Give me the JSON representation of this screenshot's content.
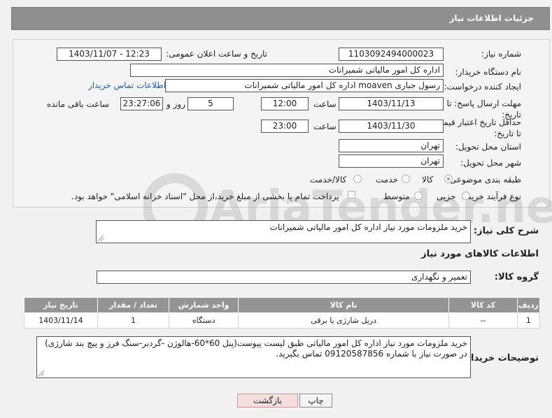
{
  "header": {
    "title": "جزئیات اطلاعات نیاز"
  },
  "fields": {
    "need_number_label": "شماره نیاز:",
    "need_number": "1103092494000023",
    "announce_label": "تاریخ و ساعت اعلان عمومی:",
    "announce_value": "1403/11/07 - 12:23",
    "buyer_org_label": "نام دستگاه خریدار:",
    "buyer_org": "اداره کل امور مالیاتی شمیرانات",
    "creator_label": "ایجاد کننده درخواست:",
    "creator": "رسول جباری moaven اداره کل امور مالیاتی شمیرانات",
    "contact_link": "اطلاعات تماس خریدار",
    "reply_deadline_label": "مهلت ارسال پاسخ: تا تاریخ:",
    "reply_date": "1403/11/13",
    "time_label": "ساعت",
    "reply_time": "12:00",
    "days_value": "5",
    "days_and_label": "روز و",
    "remaining_time": "23:27:06",
    "remaining_label": "ساعت باقی مانده",
    "price_deadline_label": "حداقل تاریخ اعتبار قیمت: تا تاریخ:",
    "price_date": "1403/11/30",
    "price_time": "23:00",
    "province_label": "استان محل تحویل:",
    "province": "تهران",
    "city_label": "شهر محل تحویل:",
    "city": "تهران",
    "category_label": "طبقه بندی موضوعی:",
    "category_options": [
      "کالا",
      "خدمت",
      "کالا/خدمت"
    ],
    "process_label": "نوع فرآیند خرید :",
    "process_options": [
      "جزیی",
      "متوسط"
    ],
    "payment_note": "پرداخت تمام یا بخشی از مبلغ خرید،از محل \"اسناد خزانه اسلامی\" خواهد بود."
  },
  "general_desc": {
    "label": "شرح کلی نیاز:",
    "value": "خرید ملزومات مورد نیاز اداره کل امور مالیاتی شمیرانات"
  },
  "goods_info_title": "اطلاعات کالاهای مورد نیاز",
  "goods_group": {
    "label": "گروه کالا:",
    "value": "تعمیر و نگهداری"
  },
  "table": {
    "headers": [
      "ردیف",
      "کد کالا",
      "نام کالا",
      "واحد شمارش",
      "تعداد / مقدار",
      "تاریخ نیاز"
    ],
    "rows": [
      [
        "1",
        "--",
        "دریل شارژی یا برقی",
        "دستگاه",
        "1",
        "1403/11/14"
      ]
    ]
  },
  "buyer_notes": {
    "label": "توضیحات خریدار:",
    "line1": "خرید ملزومات مورد نیاز اداره کل امور مالیاتی طبق لیست پیوست(پنل 60*60-هالوژن -گردبر-سنگ فرز و پیچ بند شارژی)",
    "line2": "در صورت نیاز با شماره 09120587856 تماس بگیرید."
  },
  "buttons": {
    "print": "چاپ",
    "back": "بازگشت"
  },
  "watermark_text": "AriaTender.neT",
  "colors": {
    "header_bg": "#8f8f8f",
    "link": "#1a5fb4",
    "back_btn": "#f7dede"
  }
}
